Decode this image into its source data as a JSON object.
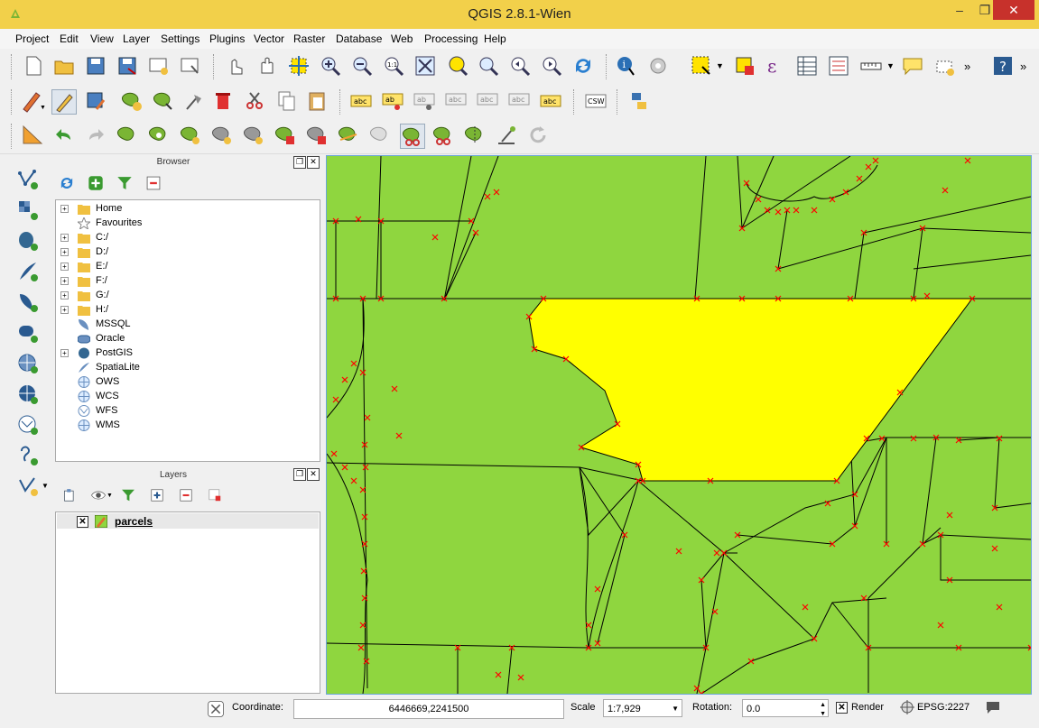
{
  "window": {
    "title": "QGIS 2.8.1-Wien"
  },
  "menu": [
    "Project",
    "Edit",
    "View",
    "Layer",
    "Settings",
    "Plugins",
    "Vector",
    "Raster",
    "Database",
    "Web",
    "Processing",
    "Help"
  ],
  "browser": {
    "title": "Browser",
    "items": [
      "Home",
      "Favourites",
      "C:/",
      "D:/",
      "E:/",
      "F:/",
      "G:/",
      "H:/",
      "MSSQL",
      "Oracle",
      "PostGIS",
      "SpatiaLite",
      "OWS",
      "WCS",
      "WFS",
      "WMS"
    ]
  },
  "layers": {
    "title": "Layers",
    "items": [
      {
        "name": "parcels",
        "visible": true
      }
    ]
  },
  "status": {
    "coordinate_label": "Coordinate:",
    "coordinate_value": "6446669,2241500",
    "scale_label": "Scale",
    "scale_value": "1:7,929",
    "rotation_label": "Rotation:",
    "rotation_value": "0.0",
    "render_label": "Render",
    "crs": "EPSG:2227"
  },
  "colors": {
    "map_fill": "#8fd63f",
    "selected_fill": "#ffff00",
    "vertex": "#ff0000",
    "titlebar": "#f2d04a"
  }
}
